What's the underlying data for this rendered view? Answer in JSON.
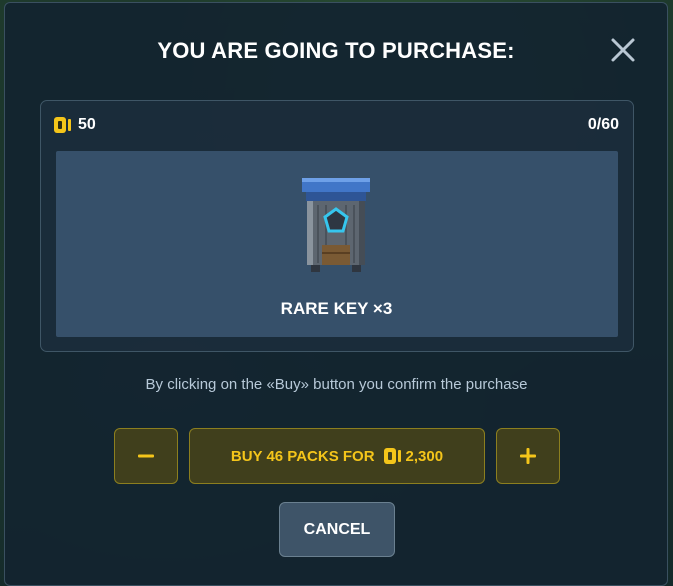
{
  "dialog": {
    "title": "YOU ARE GOING TO PURCHASE:"
  },
  "item_card": {
    "balance": "50",
    "progress": "0/60",
    "item_name": "RARE KEY ×3",
    "item_icon": "rare-key-box-icon"
  },
  "confirm_note": "By clicking on the «Buy» button you confirm the purchase",
  "actions": {
    "buy_label": "BUY 46 PACKS FOR",
    "buy_price": "2,300",
    "cancel_label": "CANCEL"
  },
  "icons": {
    "close": "close-icon",
    "currency": "coin-icon",
    "decrease": "minus-icon",
    "increase": "plus-icon"
  },
  "colors": {
    "accent_yellow": "#f4c51a",
    "button_yellow_bg": "#403f1c",
    "item_area_bg": "#36506a",
    "modal_bg": "#132430",
    "cancel_bg": "#3e5468"
  }
}
